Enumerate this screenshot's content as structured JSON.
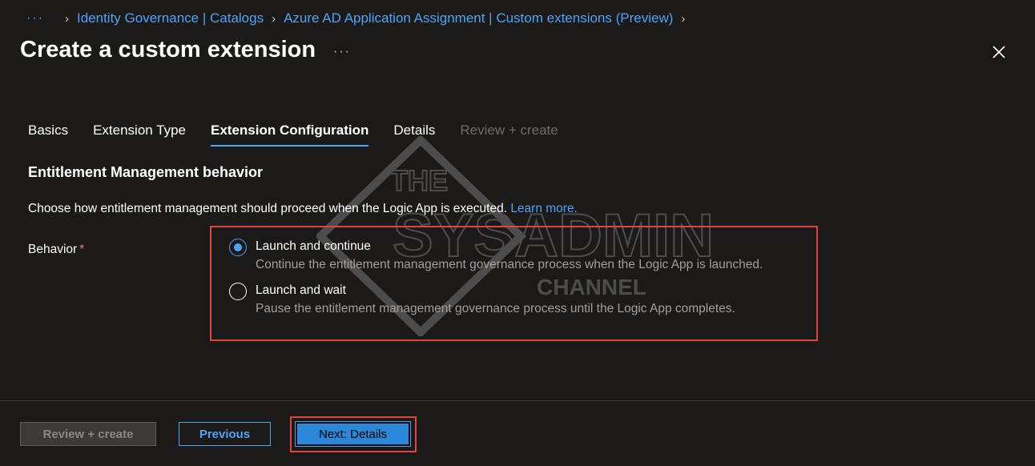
{
  "breadcrumb": {
    "more_label": "···",
    "items": [
      "Identity Governance | Catalogs",
      "Azure AD Application Assignment | Custom extensions (Preview)"
    ]
  },
  "header": {
    "title": "Create a custom extension",
    "more_label": "···"
  },
  "tabs": [
    {
      "label": "Basics",
      "state": "normal"
    },
    {
      "label": "Extension Type",
      "state": "normal"
    },
    {
      "label": "Extension Configuration",
      "state": "active"
    },
    {
      "label": "Details",
      "state": "normal"
    },
    {
      "label": "Review + create",
      "state": "disabled"
    }
  ],
  "section": {
    "title": "Entitlement Management behavior",
    "description": "Choose how entitlement management should proceed when the Logic App is executed.",
    "learn_more": "Learn more."
  },
  "behavior": {
    "label": "Behavior",
    "required_marker": "*",
    "options": [
      {
        "label": "Launch and continue",
        "description": "Continue the entitlement management governance process when the Logic App is launched.",
        "selected": true
      },
      {
        "label": "Launch and wait",
        "description": "Pause the entitlement management governance process until the Logic App completes.",
        "selected": false
      }
    ]
  },
  "footer": {
    "review_label": "Review + create",
    "previous_label": "Previous",
    "next_label": "Next: Details"
  },
  "watermark": {
    "line1": "THE",
    "line2": "SYSADMIN",
    "line3": "CHANNEL"
  },
  "colors": {
    "background": "#1b1a19",
    "accent": "#4fa3f7",
    "highlight": "#e0443f",
    "required": "#f1707b"
  },
  "icons": {
    "close": "close-icon",
    "chevron": "chevron-right-icon"
  }
}
